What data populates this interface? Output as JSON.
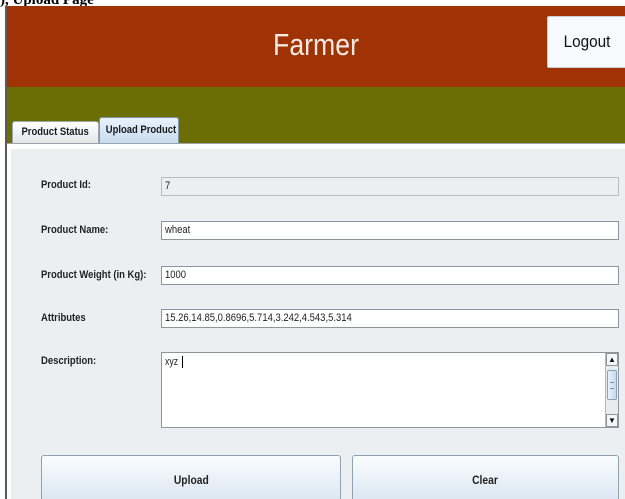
{
  "caption": {
    "text": "), Upload Page"
  },
  "header": {
    "title": "Farmer",
    "logout_label": "Logout",
    "colors": {
      "header_bg": "#a03306",
      "band_bg": "#6a6e05"
    }
  },
  "tabs": [
    {
      "label": "Product Status",
      "selected": false
    },
    {
      "label": "Upload Product",
      "selected": true
    }
  ],
  "form": {
    "product_id": {
      "label": "Product Id:",
      "value": "7"
    },
    "product_name": {
      "label": "Product Name:",
      "value": "wheat"
    },
    "product_weight": {
      "label": "Product Weight (in Kg):",
      "value": "1000"
    },
    "attributes": {
      "label": "Attributes",
      "value": "15.26,14.85,0.8696,5.714,3.242,4.543,5.314"
    },
    "description": {
      "label": "Description:",
      "value": "xyz"
    }
  },
  "scrollbar": {
    "up_icon": "▲",
    "down_icon": "▼"
  },
  "buttons": {
    "upload_label": "Upload",
    "clear_label": "Clear"
  }
}
